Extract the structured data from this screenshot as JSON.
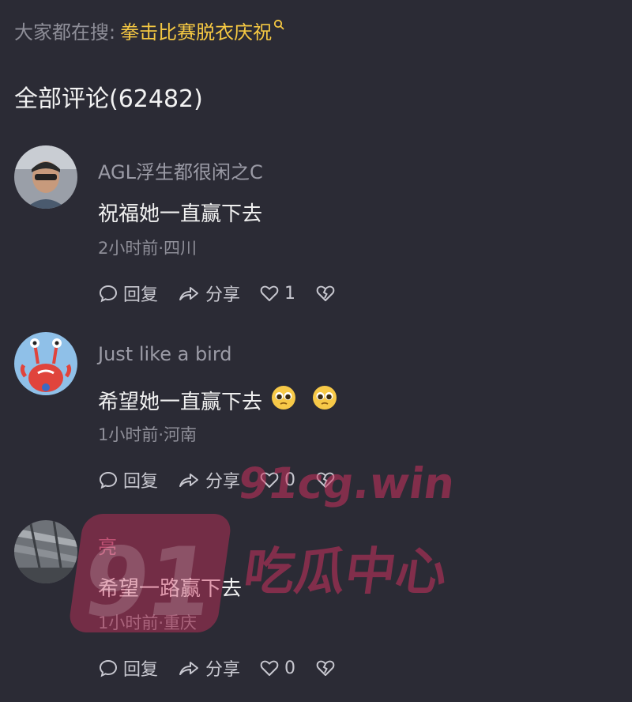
{
  "search": {
    "prefix": "大家都在搜:",
    "term": "拳击比赛脱衣庆祝"
  },
  "comments_header": "全部评论(62482)",
  "comments": [
    {
      "username": "AGL浮生都很闲之C",
      "text": "祝福她一直赢下去",
      "meta": "2小时前·四川",
      "reply_label": "回复",
      "share_label": "分享",
      "likes": "1"
    },
    {
      "username": "Just like a bird",
      "text": "希望她一直赢下去",
      "meta": "1小时前·河南",
      "reply_label": "回复",
      "share_label": "分享",
      "likes": "0"
    },
    {
      "username": "亮",
      "text": "希望一路赢下去",
      "meta": "1小时前·重庆",
      "reply_label": "回复",
      "share_label": "分享",
      "likes": "0"
    }
  ],
  "watermark": {
    "number": "91",
    "url": "91cg.win",
    "name": "吃瓜中心"
  },
  "colors": {
    "background": "#2b2b35",
    "search_highlight": "#f5c842",
    "watermark": "#cb315c"
  }
}
